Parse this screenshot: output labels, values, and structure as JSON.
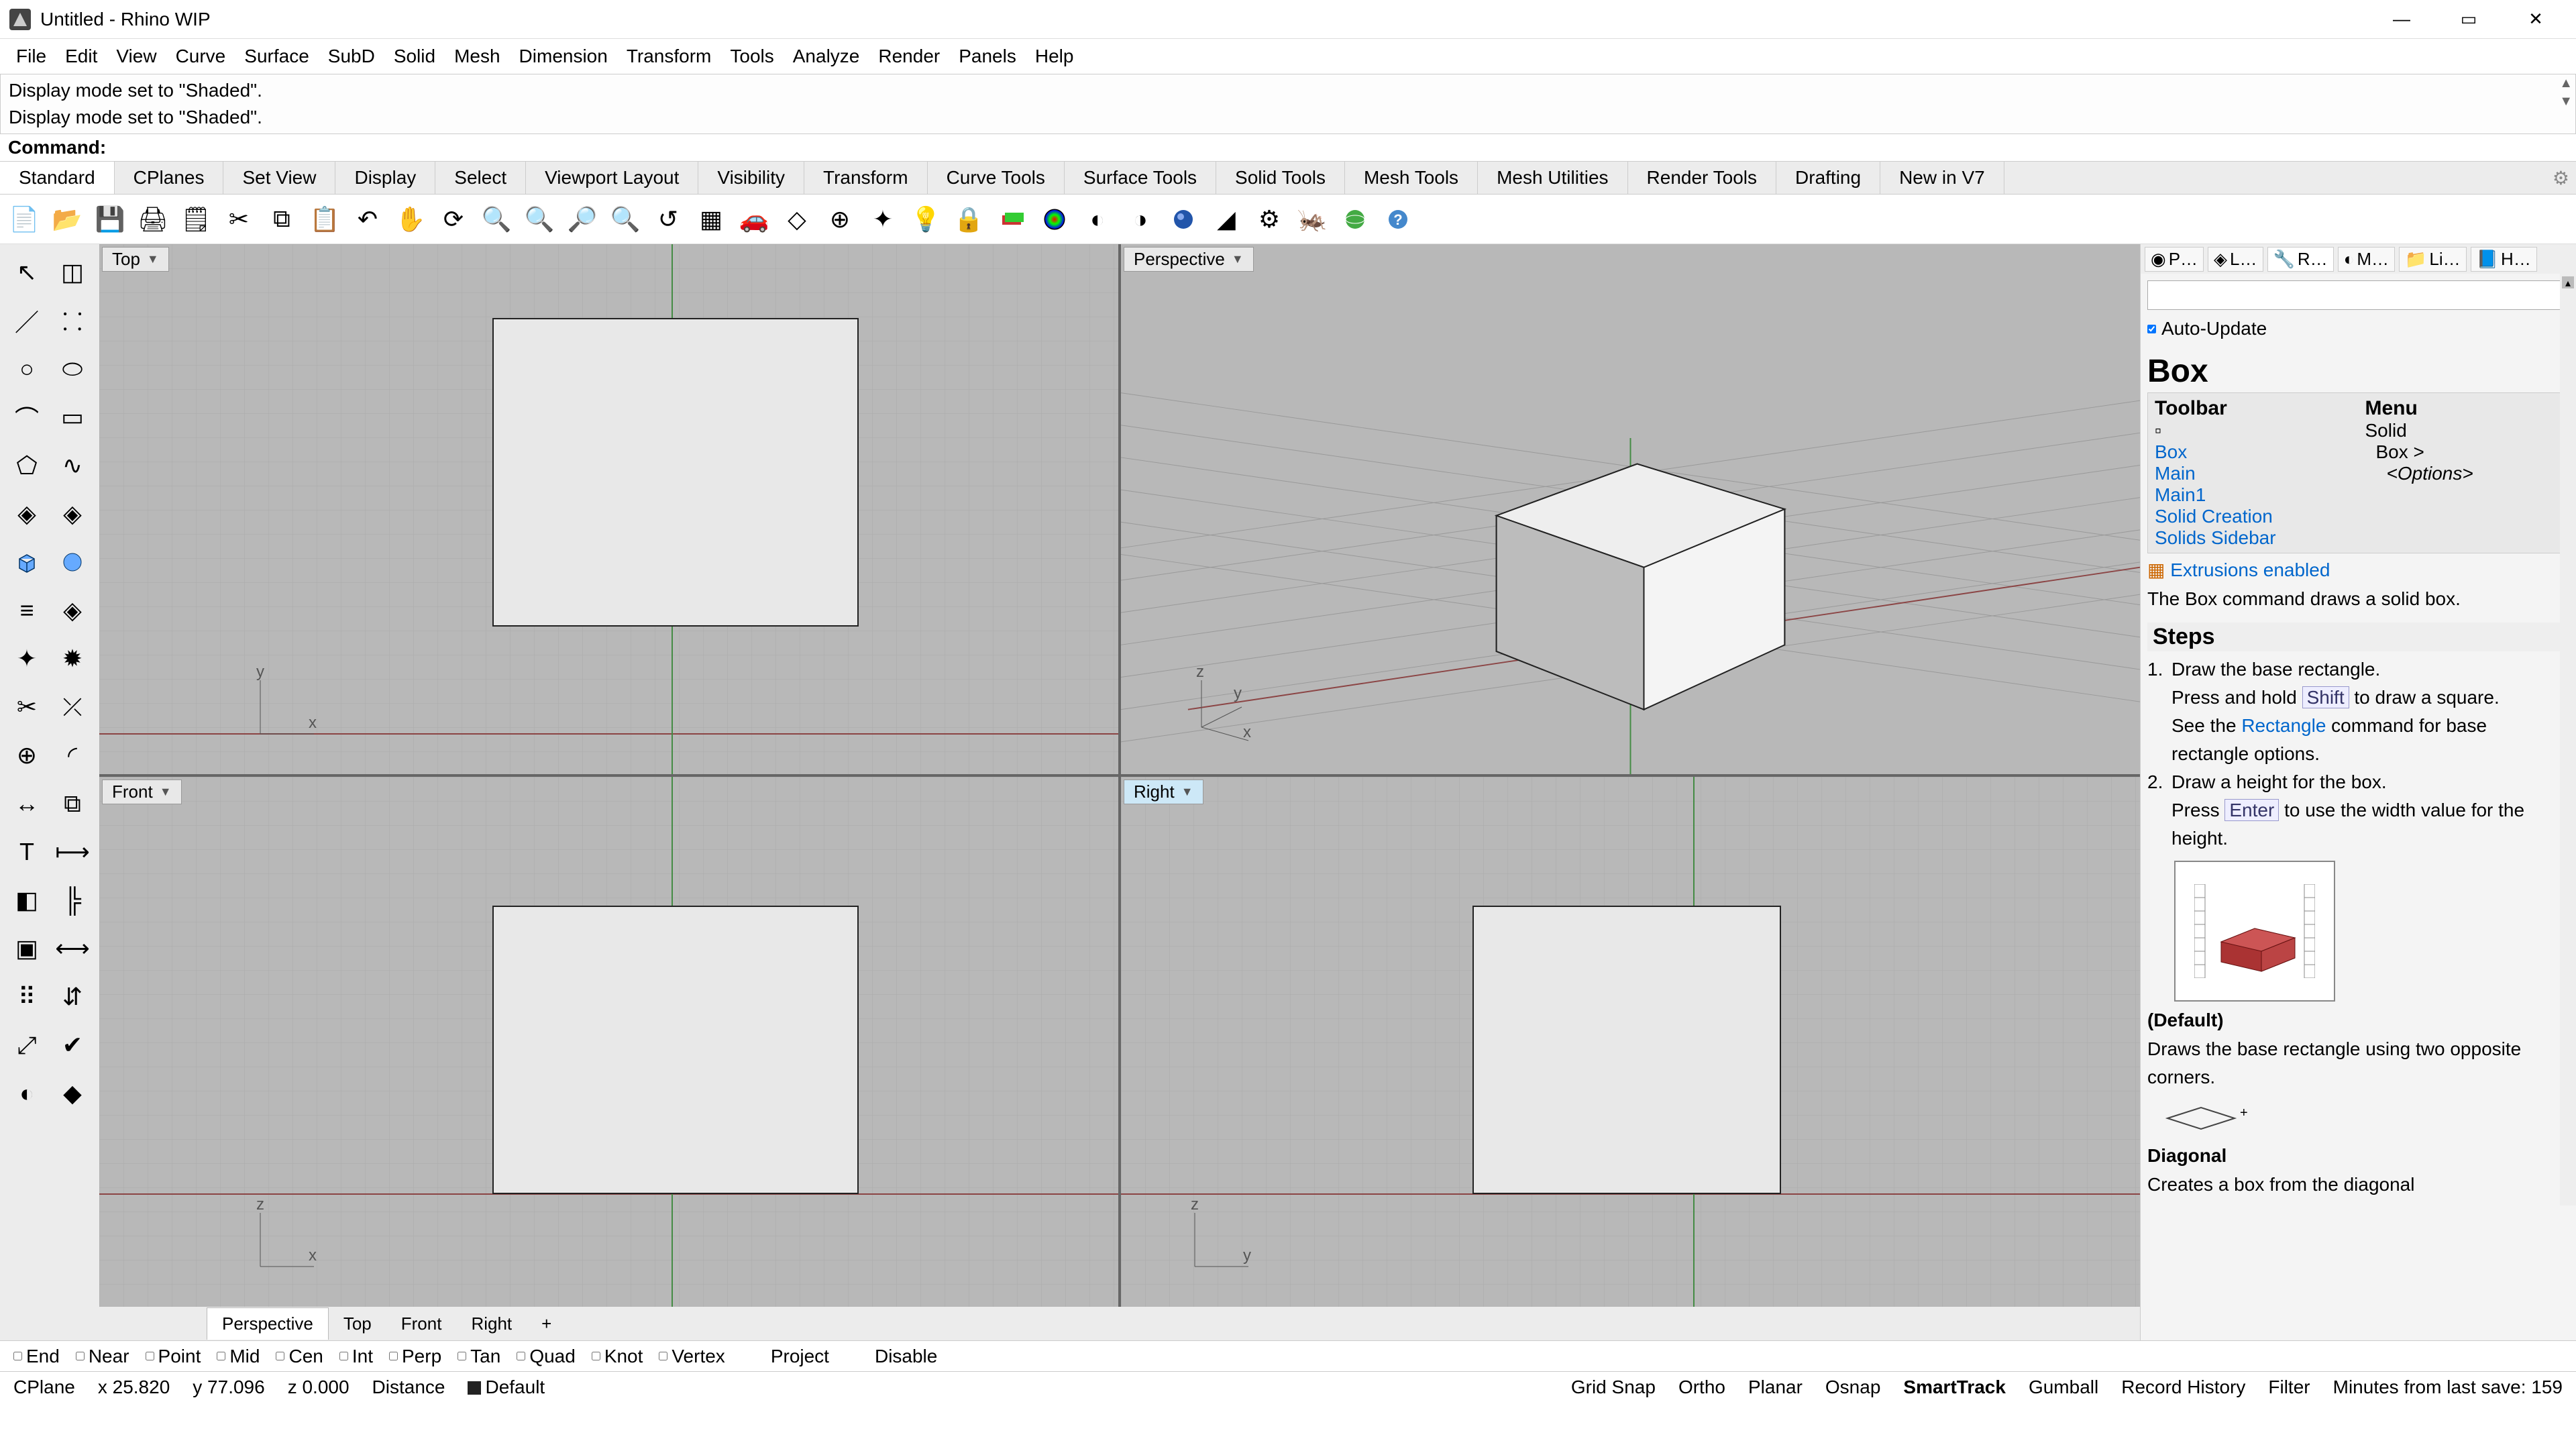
{
  "title": "Untitled - Rhino WIP",
  "menubar": [
    "File",
    "Edit",
    "View",
    "Curve",
    "Surface",
    "SubD",
    "Solid",
    "Mesh",
    "Dimension",
    "Transform",
    "Tools",
    "Analyze",
    "Render",
    "Panels",
    "Help"
  ],
  "cmdhist": [
    "Display mode set to \"Shaded\".",
    "Display mode set to \"Shaded\"."
  ],
  "cmdlabel": "Command:",
  "tabs": [
    "Standard",
    "CPlanes",
    "Set View",
    "Display",
    "Select",
    "Viewport Layout",
    "Visibility",
    "Transform",
    "Curve Tools",
    "Surface Tools",
    "Solid Tools",
    "Mesh Tools",
    "Mesh Utilities",
    "Render Tools",
    "Drafting",
    "New in V7"
  ],
  "viewports": {
    "top": "Top",
    "persp": "Perspective",
    "front": "Front",
    "right": "Right"
  },
  "vptabs": [
    "Perspective",
    "Top",
    "Front",
    "Right"
  ],
  "rtabs": [
    "P…",
    "L…",
    "R…",
    "M…",
    "Li…",
    "H…"
  ],
  "autoupdate": "Auto-Update",
  "help": {
    "title": "Box",
    "tbhead": "Toolbar",
    "menuhead": "Menu",
    "tb_items": [
      "Box",
      "Main",
      "Main1",
      "Solid Creation",
      "Solids Sidebar"
    ],
    "menu_items": [
      "Solid",
      "Box >",
      "<Options>"
    ],
    "extr": "Extrusions enabled",
    "desc": "The Box command draws a solid box.",
    "steps_title": "Steps",
    "step1a": "Draw the base rectangle.",
    "step1b_pre": "Press and hold ",
    "step1b_key": "Shift",
    "step1b_post": " to draw a square.",
    "step1c_pre": "See the ",
    "step1c_link": "Rectangle",
    "step1c_post": " command for base rectangle options.",
    "step2a": "Draw a height for the box.",
    "step2b_pre": "Press ",
    "step2b_key": "Enter",
    "step2b_post": " to use the width value for the height.",
    "default_title": "(Default)",
    "default_desc": "Draws the base rectangle using two opposite corners.",
    "diag_title": "Diagonal",
    "diag_desc": "Creates a box from the diagonal"
  },
  "osnap": [
    "End",
    "Near",
    "Point",
    "Mid",
    "Cen",
    "Int",
    "Perp",
    "Tan",
    "Quad",
    "Knot",
    "Vertex",
    "Project",
    "Disable"
  ],
  "status": {
    "cplane": "CPlane",
    "x": "x 25.820",
    "y": "y 77.096",
    "z": "z 0.000",
    "dist": "Distance",
    "layer": "Default",
    "items": [
      "Grid Snap",
      "Ortho",
      "Planar",
      "Osnap",
      "SmartTrack",
      "Gumball",
      "Record History",
      "Filter"
    ],
    "save": "Minutes from last save: 159"
  }
}
